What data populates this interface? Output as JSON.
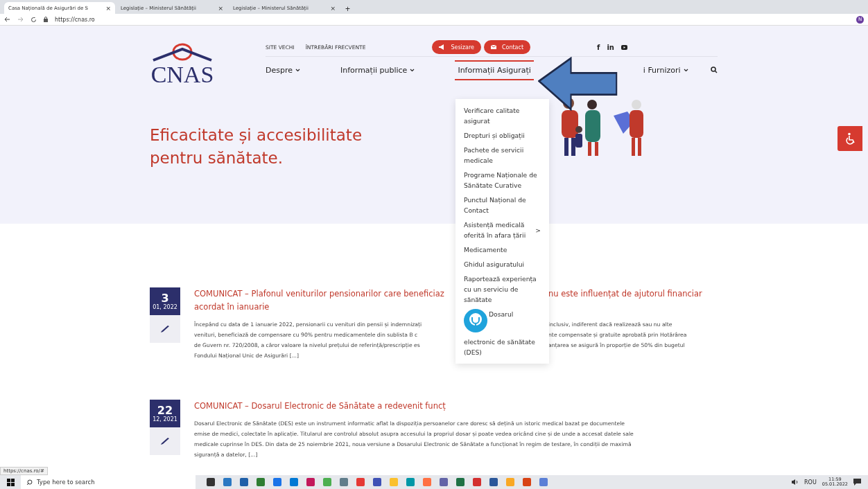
{
  "browser": {
    "tabs": [
      {
        "title": "Casa Națională de Asigurări de S",
        "selected": true
      },
      {
        "title": "Legislație – Ministerul Sănătății",
        "selected": false
      },
      {
        "title": "Legislație – Ministerul Sănătății",
        "selected": false
      }
    ],
    "tab_close": "×",
    "new_tab": "+",
    "url": "https://cnas.ro",
    "profile": "N"
  },
  "header": {
    "logo": "CNAS",
    "top_links": [
      "SITE VECHI",
      "ÎNTREBĂRI FRECVENTE"
    ],
    "buttons": [
      {
        "label": "Sesizare",
        "kind": "megaphone"
      },
      {
        "label": "Contact",
        "kind": "mail"
      }
    ],
    "social": [
      "f",
      "in"
    ],
    "nav": [
      {
        "label": "Despre",
        "selected": false,
        "chevron": true
      },
      {
        "label": "Informații publice",
        "selected": false,
        "chevron": true
      },
      {
        "label": "Informații Asigurați",
        "selected": true,
        "chevron": false
      },
      {
        "label": "i Furnizori",
        "selected": false,
        "chevron": true
      }
    ]
  },
  "dropdown": [
    {
      "label": "Verificare calitate asigurat",
      "kind": "text"
    },
    {
      "label": "Drepturi și obligații",
      "kind": "text"
    },
    {
      "label": "Pachete de servicii medicale",
      "kind": "text"
    },
    {
      "label": "Programe Naționale de Sănătate Curative",
      "kind": "text"
    },
    {
      "label": "Punctul Național de Contact",
      "kind": "text"
    },
    {
      "label": "Asistență medicală oferită în afara țării",
      "kind": "submenu",
      "arrow": ">"
    },
    {
      "label": "Medicamente",
      "kind": "text"
    },
    {
      "label": "Ghidul asiguratului",
      "kind": "text"
    },
    {
      "label": "Raportează experiența cu un serviciu de sănătate",
      "kind": "text"
    },
    {
      "label": "Dosarul",
      "label_2": "electronic de sănătate (DES)",
      "kind": "icon"
    }
  ],
  "hero": {
    "headline": "Eficacitate și accesibilitate pentru sănătate."
  },
  "articles": [
    {
      "day": "3",
      "month_year": "01, 2022",
      "title_lines": [
        {
          "left": "COMUNICAT – Plafonul veniturilor pensionarilor care beneficiaz",
          "right": "nu este influențat de ajutorul financiar"
        },
        {
          "left": "acordat în ianuarie"
        }
      ],
      "body_lines": [
        {
          "left": "Începând cu data de 1 ianuarie 2022, pensionarii cu venituri din pensii și indemnizați",
          "right": "inclusiv, indiferent dacă realizează sau nu alte"
        },
        {
          "left": "venituri, beneficiază de compensare cu 90% pentru medicamentele din sublista B c",
          "right": "nte compensate și gratuite aprobată prin Hotărârea"
        },
        {
          "left": "de Guvern nr. 720/2008, a căror valoare  la nivelul prețului de referință/prescripție es",
          "right": "anțarea se asigură în proporție de 50% din bugetul"
        },
        {
          "left": "Fondului Național Unic de Asigurări [...]"
        }
      ]
    },
    {
      "day": "22",
      "month_year": "12, 2021",
      "title_lines": [
        {
          "left": "COMUNICAT – Dosarul Electronic de Sănătate a redevenit funcț"
        }
      ],
      "body_lines": [
        {
          "left": "Dosarul Electronic de Sănătate (DES) este un instrument informatic aflat la dispoziția persoanelor care doresc să dețină un istoric medical bazat pe documentele"
        },
        {
          "left": "emise de medici, colectate în aplicație. Titularul are controlul absolut asupra accesului la propriul dosar și poate vedea oricând cine și de unde a accesat datele sale"
        },
        {
          "left": "medicale cuprinse în DES. Din data de 25 noiembrie 2021, noua versiune a Dosarului Electronic de Sănătate a funcționat în regim de testare, în condiții de maximă"
        },
        {
          "left": "siguranță a datelor, [...]"
        }
      ]
    }
  ],
  "status_url": "https://cnas.ro/#",
  "taskbar": {
    "search_placeholder": "Type here to search",
    "language": "ROU",
    "time": "11:59",
    "date": "05.01.2022"
  }
}
